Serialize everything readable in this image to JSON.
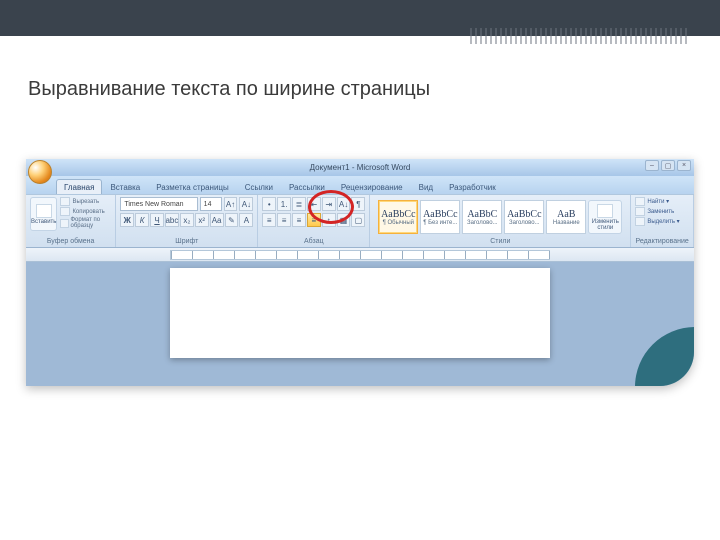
{
  "slide": {
    "title": "Выравнивание текста по ширине страницы"
  },
  "titlebar": {
    "text": "Документ1 - Microsoft Word"
  },
  "tabs": [
    "Главная",
    "Вставка",
    "Разметка страницы",
    "Ссылки",
    "Рассылки",
    "Рецензирование",
    "Вид",
    "Разработчик"
  ],
  "active_tab": 0,
  "clipboard": {
    "paste": "Вставить",
    "cut": "Вырезать",
    "copy": "Копировать",
    "format": "Формат по образцу",
    "label": "Буфер обмена"
  },
  "font": {
    "name": "Times New Roman",
    "size": "14",
    "label": "Шрифт"
  },
  "paragraph": {
    "label": "Абзац"
  },
  "styles": {
    "tiles": [
      {
        "samp": "AaBbCc",
        "name": "¶ Обычный"
      },
      {
        "samp": "AaBbCc",
        "name": "¶ Без инте..."
      },
      {
        "samp": "AaBbC",
        "name": "Заголово..."
      },
      {
        "samp": "AaBbCc",
        "name": "Заголово..."
      },
      {
        "samp": "AaB",
        "name": "Название"
      }
    ],
    "change": "Изменить\nстили",
    "label": "Стили"
  },
  "editing": {
    "find": "Найти ▾",
    "replace": "Заменить",
    "select": "Выделить ▾",
    "label": "Редактирование"
  }
}
